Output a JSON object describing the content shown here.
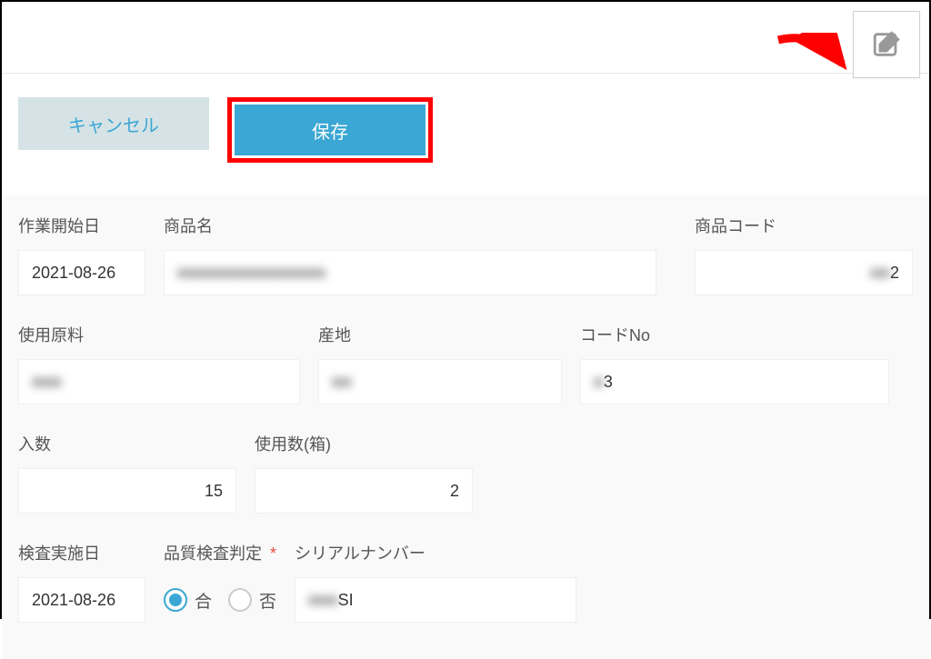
{
  "toolbar": {
    "cancel_label": "キャンセル",
    "save_label": "保存"
  },
  "fields": {
    "start_date": {
      "label": "作業開始日",
      "value": "2021-08-26"
    },
    "product_name": {
      "label": "商品名",
      "value": "■■■■■■■■■■■■■■■"
    },
    "product_code": {
      "label": "商品コード",
      "value_blur": "■■",
      "value": "2"
    },
    "material": {
      "label": "使用原料",
      "value_blur": "■■■"
    },
    "origin": {
      "label": "産地",
      "value_blur": "■■"
    },
    "code_no": {
      "label": "コードNo",
      "value_blur": "■",
      "value": "3"
    },
    "qty_in": {
      "label": "入数",
      "value": "15"
    },
    "qty_used": {
      "label": "使用数(箱)",
      "value": "2"
    },
    "inspect_date": {
      "label": "検査実施日",
      "value": "2021-08-26"
    },
    "quality": {
      "label": "品質検査判定",
      "required": "*",
      "option_pass": "合",
      "option_fail": "否",
      "selected": "pass"
    },
    "serial": {
      "label": "シリアルナンバー",
      "value_blur": "■■■",
      "value": "SI"
    }
  }
}
